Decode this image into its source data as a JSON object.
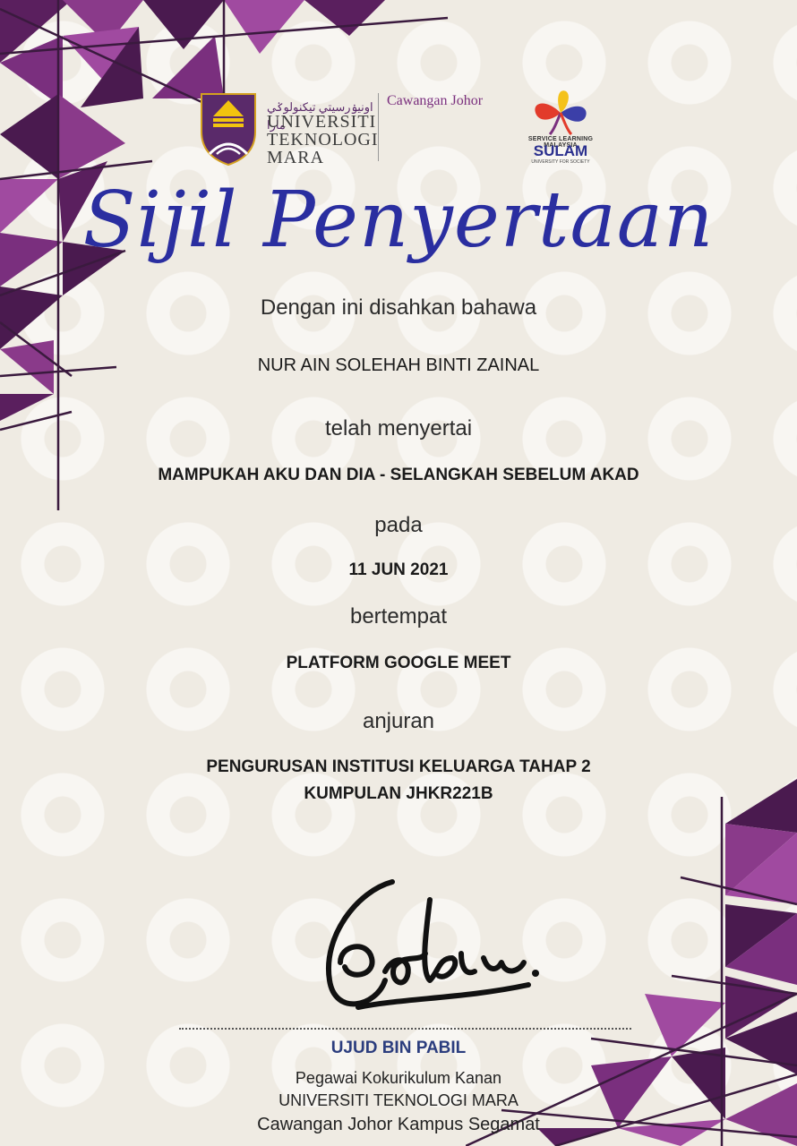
{
  "header": {
    "uitm_logo": {
      "jawi_text": "اونيۏرسيتي تيكنولوݢي مارا",
      "lines": [
        "UNIVERSITI",
        "TEKNOLOGI",
        "MARA"
      ]
    },
    "branch": "Cawangan Johor",
    "sulam_logo": {
      "tagline": "SERVICE LEARNING MALAYSIA",
      "name": "SULAM",
      "subtitle": "UNIVERSITY FOR SOCIETY"
    }
  },
  "certificate": {
    "title": "Sijil Penyertaan",
    "intro": "Dengan ini disahkan bahawa",
    "participant_name": "NUR AIN SOLEHAH BINTI ZAINAL",
    "joined_label": "telah menyertai",
    "program": "MAMPUKAH AKU DAN DIA - SELANGKAH SEBELUM AKAD",
    "on_label": "pada",
    "date": "11 JUN 2021",
    "venue_label": "bertempat",
    "venue": "PLATFORM GOOGLE MEET",
    "organizer_label": "anjuran",
    "organizer_lines": [
      "PENGURUSAN INSTITUSI KELUARGA TAHAP 2",
      "KUMPULAN JHKR221B"
    ]
  },
  "signatory": {
    "name": "UJUD BIN PABIL",
    "position": "Pegawai Kokurikulum Kanan",
    "institution": "UNIVERSITI TEKNOLOGI MARA",
    "campus": "Cawangan Johor Kampus Segamat"
  },
  "colors": {
    "title": "#2a2ea0",
    "purple_dark": "#4a1a4f",
    "purple_mid": "#7a2f7e",
    "purple_light": "#a04aa0",
    "signer": "#2b3d7e"
  }
}
